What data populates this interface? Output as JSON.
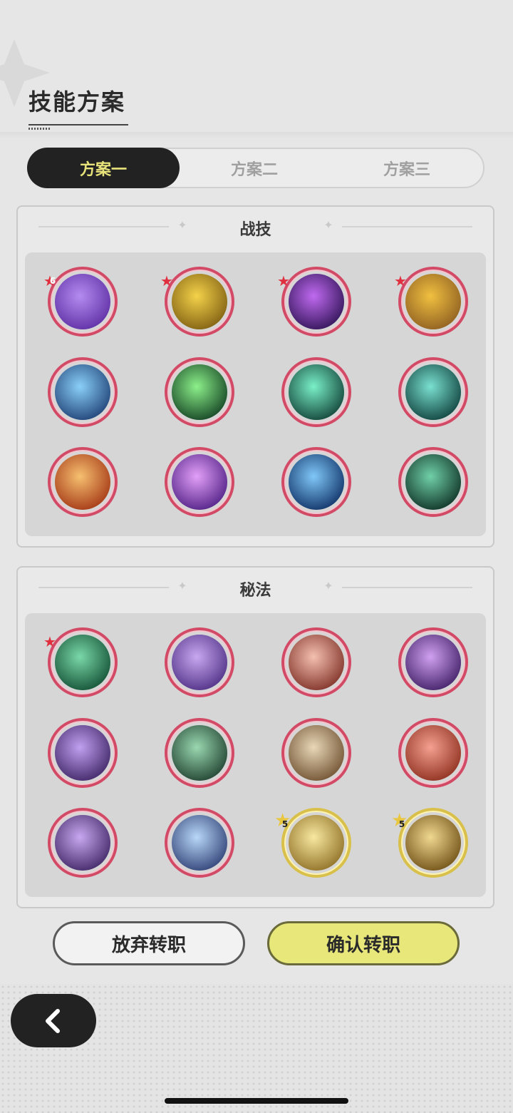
{
  "page": {
    "title": "技能方案"
  },
  "tabs": [
    {
      "label": "方案一",
      "active": true
    },
    {
      "label": "方案二",
      "active": false
    },
    {
      "label": "方案三",
      "active": false
    }
  ],
  "sections": [
    {
      "title": "战技",
      "skills": [
        {
          "icon": "purple-warrior-skill-icon",
          "badge": "6",
          "colors": [
            "#b48cf0",
            "#5a2aa0"
          ]
        },
        {
          "icon": "gold-crystal-skill-icon",
          "badge": "star",
          "colors": [
            "#f4d24a",
            "#7a5a10"
          ]
        },
        {
          "icon": "violet-star-burst-skill-icon",
          "badge": "star",
          "colors": [
            "#c06af0",
            "#2a1050"
          ]
        },
        {
          "icon": "rock-fist-skill-icon",
          "badge": "star",
          "colors": [
            "#f0c040",
            "#8a5a20"
          ]
        },
        {
          "icon": "ice-shard-skill-icon",
          "badge": "",
          "colors": [
            "#8ad0f8",
            "#1a3a70"
          ]
        },
        {
          "icon": "green-wind-skill-icon",
          "badge": "",
          "colors": [
            "#8cf08a",
            "#0e3a1e"
          ]
        },
        {
          "icon": "jade-blades-skill-icon",
          "badge": "",
          "colors": [
            "#7af0c8",
            "#0c3a30"
          ]
        },
        {
          "icon": "teal-vortex-skill-icon",
          "badge": "",
          "colors": [
            "#7ae0d0",
            "#0a3a36"
          ]
        },
        {
          "icon": "fire-wing-skill-icon",
          "badge": "",
          "colors": [
            "#f6c070",
            "#a03010"
          ]
        },
        {
          "icon": "purple-shatter-skill-icon",
          "badge": "",
          "colors": [
            "#e2a0f8",
            "#4a1a80"
          ]
        },
        {
          "icon": "blue-flame-skill-icon",
          "badge": "",
          "colors": [
            "#80c8f8",
            "#0a2a60"
          ]
        },
        {
          "icon": "thorn-vine-skill-icon",
          "badge": "",
          "colors": [
            "#70d0a8",
            "#0a2a20"
          ]
        }
      ]
    },
    {
      "title": "秘法",
      "skills": [
        {
          "icon": "green-emblem-spell-icon",
          "badge": "star",
          "colors": [
            "#7ad8a8",
            "#0e4a30"
          ],
          "gold": false
        },
        {
          "icon": "violet-hand-spell-icon",
          "badge": "",
          "colors": [
            "#c8a8f0",
            "#4a2a80"
          ],
          "gold": false
        },
        {
          "icon": "red-wave-spell-icon",
          "badge": "",
          "colors": [
            "#f4c0b0",
            "#7a2a20"
          ],
          "gold": false
        },
        {
          "icon": "violet-eye-spell-icon",
          "badge": "",
          "colors": [
            "#d0a0f0",
            "#3a1a60"
          ],
          "gold": false
        },
        {
          "icon": "purple-eye-seal-spell-icon",
          "badge": "",
          "colors": [
            "#c0a0f0",
            "#3a2060"
          ],
          "gold": false
        },
        {
          "icon": "green-clock-spell-icon",
          "badge": "",
          "colors": [
            "#9ad8b0",
            "#1a3a2a"
          ],
          "gold": false
        },
        {
          "icon": "gold-arrows-spell-icon",
          "badge": "",
          "colors": [
            "#e8d8b8",
            "#6a4a2a"
          ],
          "gold": false
        },
        {
          "icon": "red-figure-spell-icon",
          "badge": "",
          "colors": [
            "#f4a090",
            "#8a2a1a"
          ],
          "gold": false
        },
        {
          "icon": "purple-figure-up-spell-icon",
          "badge": "",
          "colors": [
            "#c8a8f0",
            "#3a2060"
          ],
          "gold": false
        },
        {
          "icon": "blue-sparkle-spell-icon",
          "badge": "",
          "colors": [
            "#b8d8f8",
            "#2a3a70"
          ],
          "gold": false
        },
        {
          "icon": "gold-feather-spell-icon",
          "badge": "5",
          "colors": [
            "#f8e8a0",
            "#8a6a20"
          ],
          "gold": true
        },
        {
          "icon": "gold-dragon-spell-icon",
          "badge": "5",
          "colors": [
            "#f0d890",
            "#6a4a10"
          ],
          "gold": true
        }
      ]
    }
  ],
  "buttons": {
    "cancel": "放弃转职",
    "confirm": "确认转职"
  }
}
